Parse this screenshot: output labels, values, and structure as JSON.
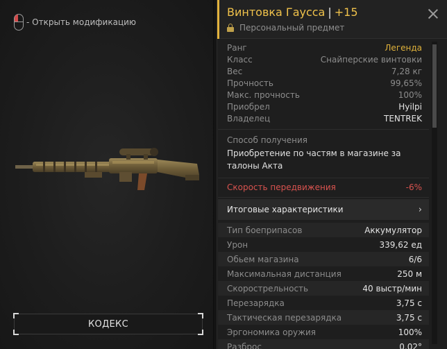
{
  "hint": {
    "icon": "mouse-left-click-icon",
    "text": "- Открыть модификацию"
  },
  "codex": {
    "label": "КОДЕКС"
  },
  "header": {
    "title": "Винтовка Гаусса",
    "separator": "|",
    "level": "+15",
    "subtitle": "Персональный предмет",
    "accent_color": "#e2b23c"
  },
  "info": [
    {
      "label": "Ранг",
      "value": "Легенда"
    },
    {
      "label": "Класс",
      "value": "Снайперские винтовки"
    },
    {
      "label": "Вес",
      "value": "7,28 кг"
    },
    {
      "label": "Прочность",
      "value": "99,65%"
    },
    {
      "label": "Макс. прочность",
      "value": "100%"
    },
    {
      "label": "Приобрел",
      "value": "Hyilpi"
    },
    {
      "label": "Владелец",
      "value": "TENTREK"
    }
  ],
  "acquisition": {
    "label": "Способ получения",
    "text": "Приобретение по частям в магазине за талоны Акта"
  },
  "movement": {
    "label": "Скорость передвижения",
    "value": "-6%"
  },
  "totals": {
    "label": "Итоговые характеристики",
    "chevron": "›"
  },
  "stats": [
    {
      "label": "Тип боеприпасов",
      "value": "Аккумулятор"
    },
    {
      "label": "Урон",
      "value": "339,62 ед"
    },
    {
      "label": "Обьем магазина",
      "value": "6/6"
    },
    {
      "label": "Максимальная дистанция",
      "value": "250 м"
    },
    {
      "label": "Скорострельность",
      "value": "40 выстр/мин"
    },
    {
      "label": "Перезарядка",
      "value": "3,75 с"
    },
    {
      "label": "Тактическая перезарядка",
      "value": "3,75 с"
    },
    {
      "label": "Эргономика оружия",
      "value": "100%"
    },
    {
      "label": "Разброс",
      "value": "0,02°"
    }
  ]
}
